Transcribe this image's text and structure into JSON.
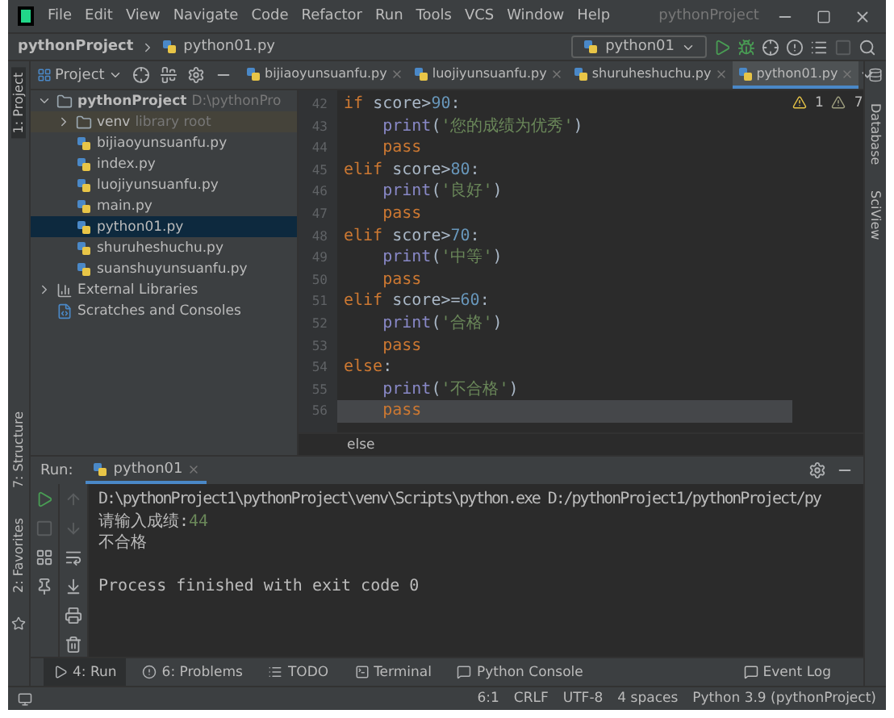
{
  "window": {
    "title": "pythonProject",
    "menu": [
      "File",
      "Edit",
      "View",
      "Navigate",
      "Code",
      "Refactor",
      "Run",
      "Tools",
      "VCS",
      "Window",
      "Help"
    ]
  },
  "navbar": {
    "project": "pythonProject",
    "file": "python01.py",
    "run_config": "python01"
  },
  "project_panel": {
    "title": "Project",
    "tree": [
      {
        "label": "pythonProject",
        "hint": "D:\\pythonPro",
        "kind": "folder",
        "expanded": true,
        "selected": false,
        "children": [
          {
            "label": "venv",
            "hint": "library root",
            "kind": "folder",
            "expanded": false,
            "selected": false
          },
          {
            "label": "bijiaoyunsuanfu.py",
            "kind": "file",
            "selected": false
          },
          {
            "label": "index.py",
            "kind": "file",
            "selected": false
          },
          {
            "label": "luojiyunsuanfu.py",
            "kind": "file",
            "selected": false
          },
          {
            "label": "main.py",
            "kind": "file",
            "selected": false
          },
          {
            "label": "python01.py",
            "kind": "file",
            "selected": true
          },
          {
            "label": "shuruheshuchu.py",
            "kind": "file",
            "selected": false
          },
          {
            "label": "suanshuyunsuanfu.py",
            "kind": "file",
            "selected": false
          }
        ]
      },
      {
        "label": "External Libraries",
        "kind": "library",
        "expanded": false,
        "selected": false
      },
      {
        "label": "Scratches and Consoles",
        "kind": "scratch",
        "selected": false
      }
    ]
  },
  "editor_tabs": [
    {
      "label": "bijiaoyunsuanfu.py",
      "selected": false
    },
    {
      "label": "luojiyunsuanfu.py",
      "selected": false
    },
    {
      "label": "shuruheshuchu.py",
      "selected": false
    },
    {
      "label": "python01.py",
      "selected": true
    }
  ],
  "inspections": {
    "errors": "1",
    "warnings": "7"
  },
  "code": [
    {
      "number": "42",
      "current": false,
      "tokens": [
        {
          "kind": "keyword",
          "text": "if"
        },
        {
          "kind": "plain",
          "text": " score>"
        },
        {
          "kind": "number",
          "text": "90"
        },
        {
          "kind": "plain",
          "text": ":"
        }
      ]
    },
    {
      "number": "43",
      "current": false,
      "tokens": [
        {
          "kind": "builtin",
          "text": "    print"
        },
        {
          "kind": "plain",
          "text": "("
        },
        {
          "kind": "string",
          "text": "'您的成绩为优秀'"
        },
        {
          "kind": "plain",
          "text": ")"
        }
      ]
    },
    {
      "number": "44",
      "current": false,
      "tokens": [
        {
          "kind": "keyword",
          "text": "    pass"
        }
      ]
    },
    {
      "number": "45",
      "current": false,
      "tokens": [
        {
          "kind": "keyword",
          "text": "elif"
        },
        {
          "kind": "plain",
          "text": " score>"
        },
        {
          "kind": "number",
          "text": "80"
        },
        {
          "kind": "plain",
          "text": ":"
        }
      ]
    },
    {
      "number": "46",
      "current": false,
      "tokens": [
        {
          "kind": "builtin",
          "text": "    print"
        },
        {
          "kind": "plain",
          "text": "("
        },
        {
          "kind": "string",
          "text": "'良好'"
        },
        {
          "kind": "plain",
          "text": ")"
        }
      ]
    },
    {
      "number": "47",
      "current": false,
      "tokens": [
        {
          "kind": "keyword",
          "text": "    pass"
        }
      ]
    },
    {
      "number": "48",
      "current": false,
      "tokens": [
        {
          "kind": "keyword",
          "text": "elif"
        },
        {
          "kind": "plain",
          "text": " score>"
        },
        {
          "kind": "number",
          "text": "70"
        },
        {
          "kind": "plain",
          "text": ":"
        }
      ]
    },
    {
      "number": "49",
      "current": false,
      "tokens": [
        {
          "kind": "builtin",
          "text": "    print"
        },
        {
          "kind": "plain",
          "text": "("
        },
        {
          "kind": "string",
          "text": "'中等'"
        },
        {
          "kind": "plain",
          "text": ")"
        }
      ]
    },
    {
      "number": "50",
      "current": false,
      "tokens": [
        {
          "kind": "keyword",
          "text": "    pass"
        }
      ]
    },
    {
      "number": "51",
      "current": false,
      "tokens": [
        {
          "kind": "keyword",
          "text": "elif"
        },
        {
          "kind": "plain",
          "text": " score>="
        },
        {
          "kind": "number",
          "text": "60"
        },
        {
          "kind": "plain",
          "text": ":"
        }
      ]
    },
    {
      "number": "52",
      "current": false,
      "tokens": [
        {
          "kind": "builtin",
          "text": "    print"
        },
        {
          "kind": "plain",
          "text": "("
        },
        {
          "kind": "string",
          "text": "'合格'"
        },
        {
          "kind": "plain",
          "text": ")"
        }
      ]
    },
    {
      "number": "53",
      "current": false,
      "tokens": [
        {
          "kind": "keyword",
          "text": "    pass"
        }
      ]
    },
    {
      "number": "54",
      "current": false,
      "tokens": [
        {
          "kind": "keyword",
          "text": "else"
        },
        {
          "kind": "plain",
          "text": ":"
        }
      ]
    },
    {
      "number": "55",
      "current": false,
      "tokens": [
        {
          "kind": "builtin",
          "text": "    print"
        },
        {
          "kind": "plain",
          "text": "("
        },
        {
          "kind": "string",
          "text": "'不合格'"
        },
        {
          "kind": "plain",
          "text": ")"
        }
      ]
    },
    {
      "number": "56",
      "current": true,
      "tokens": [
        {
          "kind": "keyword",
          "text": "    pass"
        }
      ]
    }
  ],
  "breadcrumb": "else",
  "left_strip": [
    "1: Project",
    "7: Structure",
    "2: Favorites"
  ],
  "right_strip": [
    "Database",
    "SciView"
  ],
  "run_panel": {
    "label": "Run:",
    "tab": "python01",
    "console": [
      {
        "kind": "command",
        "text": "D:\\pythonProject1\\pythonProject\\venv\\Scripts\\python.exe D:/pythonProject1/pythonProject/py"
      },
      {
        "kind": "input",
        "text": "请输入成绩:",
        "value": "44"
      },
      {
        "kind": "text",
        "text": "不合格"
      },
      {
        "kind": "blank"
      },
      {
        "kind": "text",
        "text": "Process finished with exit code 0"
      }
    ]
  },
  "tool_tabs": [
    {
      "label": "4: Run",
      "kind": "run",
      "selected": true
    },
    {
      "label": "6: Problems",
      "kind": "problems",
      "selected": false
    },
    {
      "label": "TODO",
      "kind": "todo",
      "selected": false
    },
    {
      "label": "Terminal",
      "kind": "terminal",
      "selected": false
    },
    {
      "label": "Python Console",
      "kind": "console",
      "selected": false
    }
  ],
  "event_log": "Event Log",
  "status_bar": [
    "6:1",
    "CRLF",
    "UTF-8",
    "4 spaces",
    "Python 3.9 (pythonProject)"
  ]
}
